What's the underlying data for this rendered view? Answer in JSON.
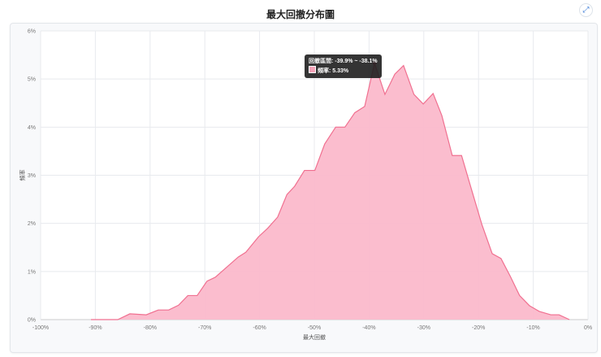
{
  "chart_data": {
    "type": "area",
    "title": "最大回撤分布圖",
    "xlabel": "最大回撤",
    "ylabel": "頻率",
    "xlim": [
      -100,
      0
    ],
    "ylim": [
      0,
      6
    ],
    "x_ticks": [
      "-100%",
      "-90%",
      "-80%",
      "-70%",
      "-60%",
      "-50%",
      "-40%",
      "-30%",
      "-20%",
      "-10%",
      "0%"
    ],
    "y_ticks": [
      "0%",
      "1%",
      "2%",
      "3%",
      "4%",
      "5%",
      "6%"
    ],
    "grid": true,
    "color": "#f07090",
    "fill": "#fbb9cb",
    "x": [
      -90.8,
      -85.9,
      -83.7,
      -80.7,
      -78.5,
      -76.6,
      -74.8,
      -73.1,
      -71.4,
      -69.6,
      -68.1,
      -66.3,
      -63.9,
      -62.5,
      -60.2,
      -58.5,
      -56.7,
      -55.0,
      -53.6,
      -51.8,
      -49.9,
      -48.1,
      -46.1,
      -44.4,
      -42.6,
      -40.8,
      -39.0,
      -37.1,
      -35.3,
      -33.7,
      -31.8,
      -30.1,
      -28.3,
      -26.7,
      -24.8,
      -23.1,
      -21.4,
      -19.4,
      -17.5,
      -15.9,
      -14.2,
      -12.5,
      -10.7,
      -8.9,
      -6.8,
      -5.3,
      -3.4
    ],
    "values": [
      0,
      0,
      0.12,
      0.1,
      0.2,
      0.2,
      0.3,
      0.5,
      0.5,
      0.8,
      0.88,
      1.06,
      1.3,
      1.4,
      1.72,
      1.9,
      2.13,
      2.6,
      2.77,
      3.1,
      3.1,
      3.65,
      4.0,
      4.0,
      4.3,
      4.43,
      5.33,
      4.68,
      5.1,
      5.28,
      4.68,
      4.48,
      4.7,
      4.24,
      3.41,
      3.41,
      2.75,
      1.98,
      1.37,
      1.27,
      0.9,
      0.5,
      0.29,
      0.17,
      0.1,
      0.1,
      0
    ],
    "tooltip": {
      "range_label": "回撤區間: -39.9% ~ -38.1%",
      "freq_label": "頻率: 5.33%"
    },
    "highlight_index": 26
  }
}
